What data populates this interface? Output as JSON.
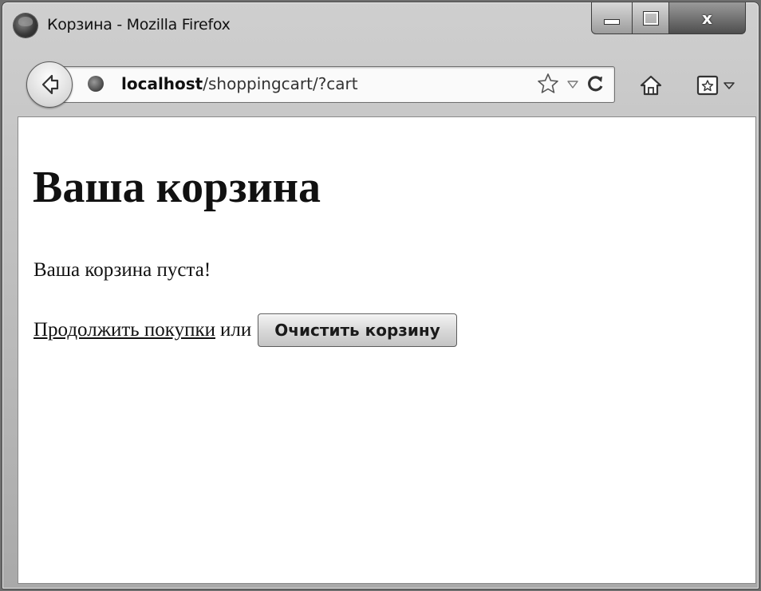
{
  "window": {
    "title": "Корзина - Mozilla Firefox",
    "controls": {
      "minimize": "minimize-icon",
      "maximize": "maximize-icon",
      "close_label": "x"
    }
  },
  "navbar": {
    "url_host": "localhost",
    "url_path": "/shoppingcart/?cart",
    "icons": [
      "back-arrow-icon",
      "globe-icon",
      "star-icon",
      "dropdown-icon",
      "reload-icon",
      "home-icon",
      "bookmarks-icon"
    ]
  },
  "page": {
    "heading": "Ваша корзина",
    "empty_message": "Ваша корзина пуста!",
    "continue_link": "Продолжить покупки",
    "or_text": "или",
    "clear_button": "Очистить корзину"
  },
  "colors": {
    "chrome": "#bdbdbd",
    "content_bg": "#ffffff",
    "text": "#111111"
  }
}
